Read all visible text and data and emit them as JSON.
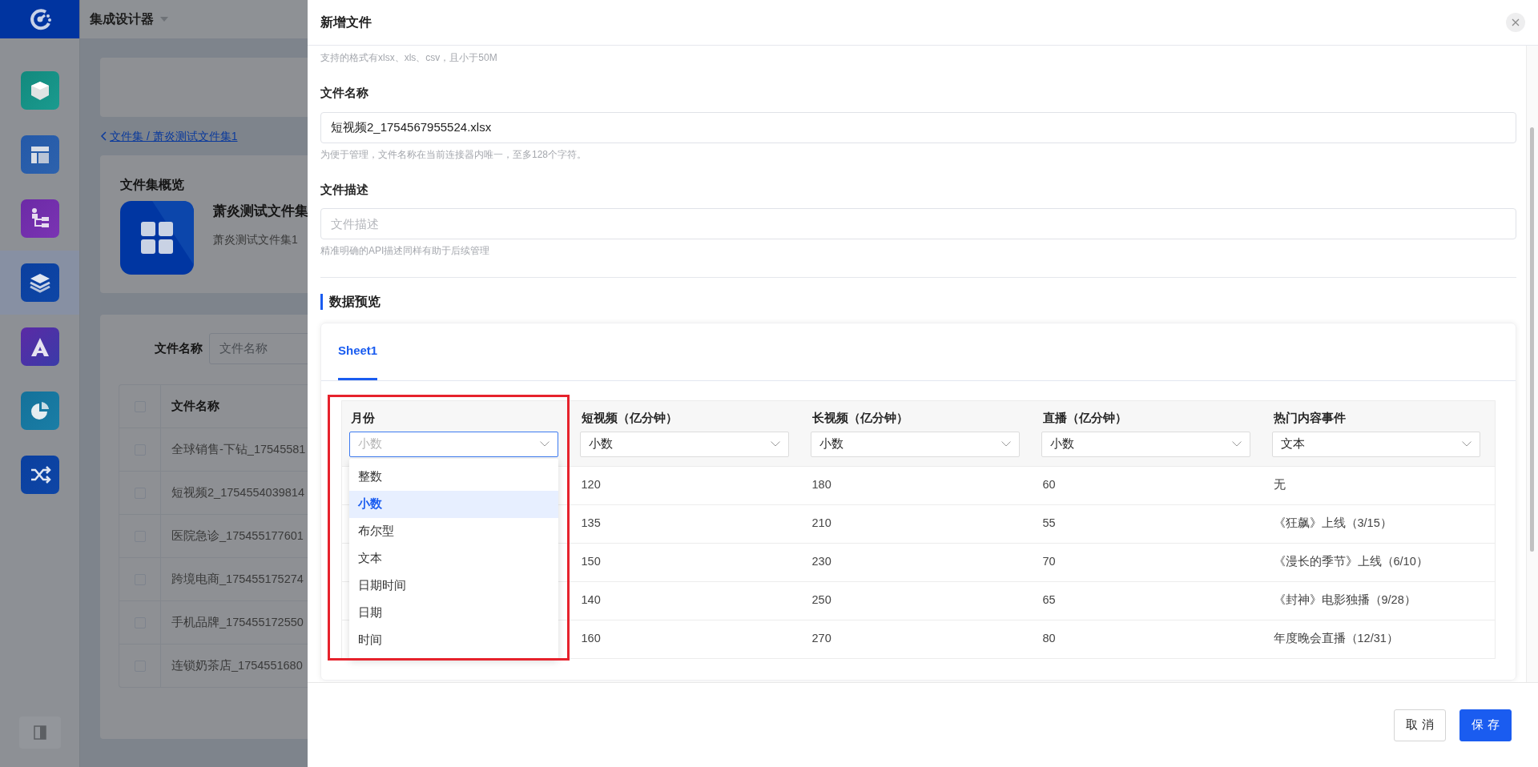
{
  "app": {
    "title": "集成设计器"
  },
  "sidebar": {
    "items": [
      {
        "selected": false
      },
      {
        "selected": false
      },
      {
        "selected": false
      },
      {
        "selected": true
      },
      {
        "selected": false
      },
      {
        "selected": false
      },
      {
        "selected": false
      }
    ]
  },
  "page": {
    "breadcrumb": "文件集 / 萧炎测试文件集1",
    "overview": {
      "title": "文件集概览",
      "name": "萧炎测试文件集",
      "description": "萧炎测试文件集1"
    },
    "filter": {
      "label": "文件名称",
      "placeholder": "文件名称"
    },
    "table": {
      "columns": [
        "文件名称"
      ],
      "header_checked": false,
      "rows": [
        {
          "checked": false,
          "name": "全球销售-下钻_17545581"
        },
        {
          "checked": false,
          "name": "短视频2_1754554039814"
        },
        {
          "checked": false,
          "name": "医院急诊_175455177601"
        },
        {
          "checked": false,
          "name": "跨境电商_175455175274"
        },
        {
          "checked": false,
          "name": "手机品牌_175455172550"
        },
        {
          "checked": false,
          "name": "连锁奶茶店_1754551680"
        }
      ]
    }
  },
  "drawer": {
    "title": "新增文件",
    "format_hint": "支持的格式有xlsx、xls、csv，且小于50M",
    "fields": [
      {
        "label": "文件名称",
        "value": "短视频2_1754567955524.xlsx",
        "hint": "为便于管理，文件名称在当前连接器内唯一，至多128个字符。"
      },
      {
        "label": "文件描述",
        "placeholder": "文件描述",
        "hint": "精准明确的API描述同样有助于后续管理"
      }
    ],
    "preview": {
      "title": "数据预览",
      "tabs": [
        {
          "label": "Sheet1",
          "selected": true
        }
      ],
      "table": {
        "columns": [
          {
            "name": "月份",
            "type": "小数",
            "open": true,
            "highlighted": true
          },
          {
            "name": "短视频（亿分钟）",
            "type": "小数",
            "open": false,
            "highlighted": false
          },
          {
            "name": "长视频（亿分钟）",
            "type": "小数",
            "open": false,
            "highlighted": false
          },
          {
            "name": "直播（亿分钟）",
            "type": "小数",
            "open": false,
            "highlighted": false
          },
          {
            "name": "热门内容事件",
            "type": "文本",
            "open": false,
            "highlighted": false
          }
        ],
        "rows": [
          {
            "cells": [
              "",
              "120",
              "180",
              "60",
              "无"
            ]
          },
          {
            "cells": [
              "",
              "135",
              "210",
              "55",
              "《狂飙》上线（3/15）"
            ]
          },
          {
            "cells": [
              "",
              "150",
              "230",
              "70",
              "《漫长的季节》上线（6/10）"
            ]
          },
          {
            "cells": [
              "",
              "140",
              "250",
              "65",
              "《封神》电影独播（9/28）"
            ]
          },
          {
            "cells": [
              "",
              "160",
              "270",
              "80",
              "年度晚会直播（12/31）"
            ]
          }
        ]
      },
      "dropdown": {
        "options": [
          {
            "label": "整数",
            "selected": false
          },
          {
            "label": "小数",
            "selected": true
          },
          {
            "label": "布尔型",
            "selected": false
          },
          {
            "label": "文本",
            "selected": false
          },
          {
            "label": "日期时间",
            "selected": false
          },
          {
            "label": "日期",
            "selected": false
          },
          {
            "label": "时间",
            "selected": false
          }
        ]
      }
    },
    "buttons": [
      {
        "label": "取 消",
        "kind": "default"
      },
      {
        "label": "保 存",
        "kind": "primary"
      }
    ]
  }
}
